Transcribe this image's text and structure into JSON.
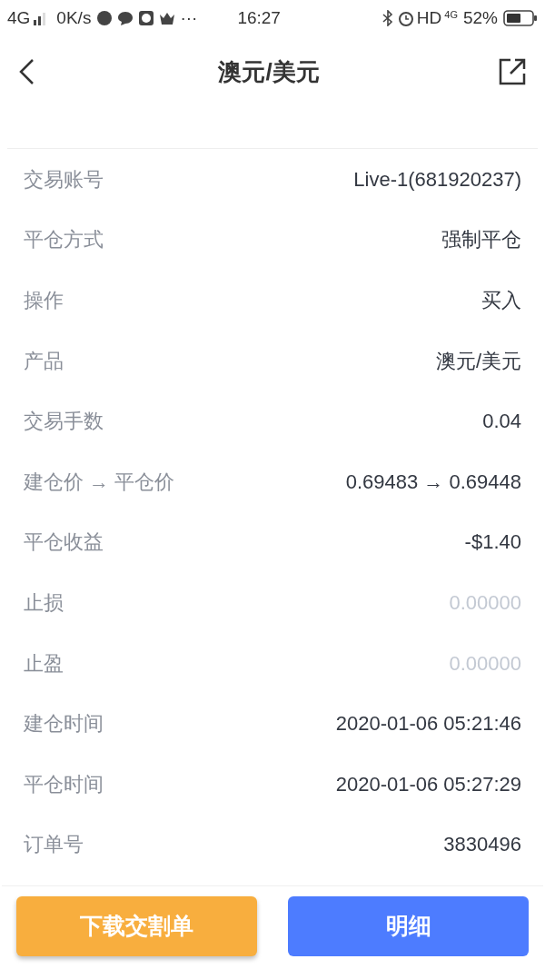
{
  "status_bar": {
    "network": "4G",
    "speed": "0K/s",
    "more": "···",
    "time": "16:27",
    "hd": "HD",
    "network_right": "4G",
    "battery": "52%"
  },
  "header": {
    "title": "澳元/美元"
  },
  "rows": [
    {
      "label": "交易账号",
      "value": "Live-1(681920237)",
      "muted": false
    },
    {
      "label": "平仓方式",
      "value": "强制平仓",
      "muted": false
    },
    {
      "label": "操作",
      "value": "买入",
      "muted": false
    },
    {
      "label": "产品",
      "value": "澳元/美元",
      "muted": false
    },
    {
      "label": "交易手数",
      "value": "0.04",
      "muted": false
    },
    {
      "label": "建仓价 → 平仓价",
      "value": "0.69483 → 0.69448",
      "muted": false
    },
    {
      "label": "平仓收益",
      "value": "-$1.40",
      "muted": false
    },
    {
      "label": "止损",
      "value": "0.00000",
      "muted": true
    },
    {
      "label": "止盈",
      "value": "0.00000",
      "muted": true
    },
    {
      "label": "建仓时间",
      "value": "2020-01-06 05:21:46",
      "muted": false
    },
    {
      "label": "平仓时间",
      "value": "2020-01-06 05:27:29",
      "muted": false
    },
    {
      "label": "订单号",
      "value": "3830496",
      "muted": false
    }
  ],
  "buttons": [
    {
      "label": "下载交割单",
      "kind": "secondary"
    },
    {
      "label": "明细",
      "kind": "primary"
    }
  ]
}
